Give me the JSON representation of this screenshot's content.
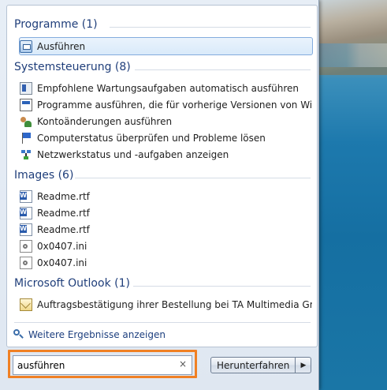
{
  "search": {
    "value": "ausführen",
    "clear_glyph": "×",
    "more_results_label": "Weitere Ergebnisse anzeigen"
  },
  "groups": [
    {
      "title": "Programme (1)",
      "items": [
        {
          "label": "Ausführen",
          "icon": "run-icon",
          "selected": true
        }
      ]
    },
    {
      "title": "Systemsteuerung (8)",
      "items": [
        {
          "label": "Empfohlene Wartungsaufgaben automatisch ausführen",
          "icon": "maintenance-icon"
        },
        {
          "label": "Programme ausführen, die für vorherige Versionen von Windo...",
          "icon": "compatibility-icon"
        },
        {
          "label": "Kontoänderungen ausführen",
          "icon": "user-accounts-icon"
        },
        {
          "label": "Computerstatus überprüfen und Probleme lösen",
          "icon": "action-center-flag-icon"
        },
        {
          "label": "Netzwerkstatus und -aufgaben anzeigen",
          "icon": "network-icon"
        }
      ]
    },
    {
      "title": "Images (6)",
      "items": [
        {
          "label": "Readme.rtf",
          "icon": "word-document-icon"
        },
        {
          "label": "Readme.rtf",
          "icon": "word-document-icon"
        },
        {
          "label": "Readme.rtf",
          "icon": "word-document-icon"
        },
        {
          "label": "0x0407.ini",
          "icon": "ini-file-icon"
        },
        {
          "label": "0x0407.ini",
          "icon": "ini-file-icon"
        }
      ]
    },
    {
      "title": "Microsoft Outlook (1)",
      "items": [
        {
          "label": "Auftragsbestätigung ihrer Bestellung bei TA Multimedia GmbH",
          "icon": "mail-icon"
        }
      ]
    }
  ],
  "shutdown": {
    "label": "Herunterfahren",
    "arrow_glyph": "▶"
  },
  "colors": {
    "highlight_border": "#f08024",
    "group_header": "#1f3e7a",
    "selection_border": "#84acdd"
  }
}
